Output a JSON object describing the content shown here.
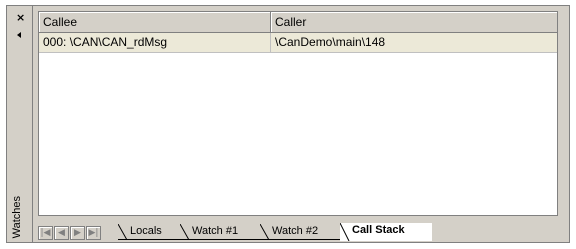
{
  "window": {
    "side_title": "Watches",
    "close_glyph": "×"
  },
  "table": {
    "columns": [
      "Callee",
      "Caller"
    ],
    "rows": [
      {
        "callee": "000: \\CAN\\CAN_rdMsg",
        "caller": "\\CanDemo\\main\\148"
      }
    ]
  },
  "tabs": [
    {
      "label": "Locals",
      "active": false
    },
    {
      "label": "Watch #1",
      "active": false
    },
    {
      "label": "Watch #2",
      "active": false
    },
    {
      "label": "Call Stack",
      "active": true
    }
  ],
  "nav_icons": [
    "first-page-icon",
    "prev-page-icon",
    "next-page-icon",
    "last-page-icon"
  ]
}
